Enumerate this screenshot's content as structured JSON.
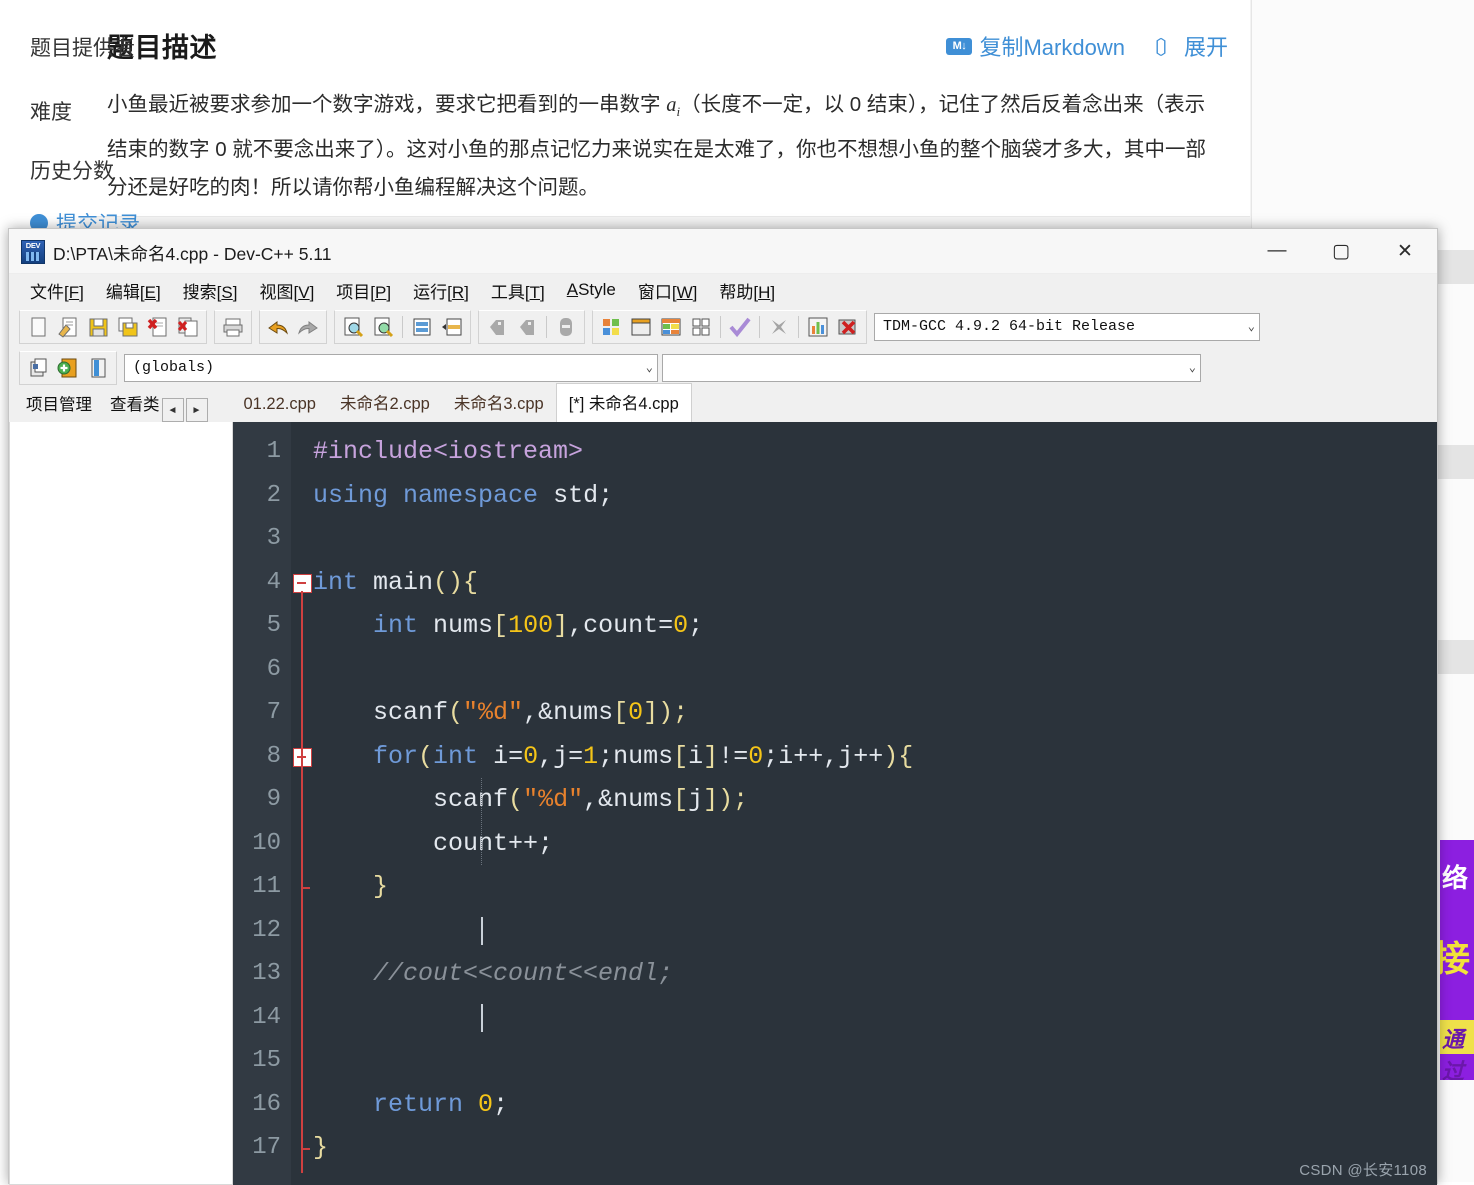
{
  "webpage": {
    "card_title": "题目描述",
    "actions": {
      "copy_markdown": "复制Markdown",
      "copy_markdown_icon": "markdown-badge-icon",
      "expand": "展开",
      "expand_icon": "expand-brackets-icon"
    },
    "description_lines": [
      "小鱼最近被要求参加一个数字游戏，要求它把看到的一串数字 a_i（长度不一定，以 0 结束），记住了然后",
      "反着念出来（表示结束的数字 0 就不要念出来了）。这对小鱼的那点记忆力来说实在是太难了，你也不想",
      "想小鱼的整个脑袋才多大，其中一部分还是好吃的肉！所以请你帮小鱼编程解决这个问题。"
    ],
    "description_part1": "小鱼最近被要求参加一个数字游戏，要求它把看到的一串数字 ",
    "description_var": "a",
    "description_sub": "i",
    "description_part2": "（长度不一定，以 0 结束），记住了然后反着念出来（表示结束的数字 0 就不要念出来了）。这对小鱼的那点记忆力来说实在是太难了，你也不想想小鱼的整个脑袋才多大，其中一部分还是好吃的肉！所以请你帮小鱼编程解决这个问题。",
    "sidebar_items": [
      {
        "label": "题目提供者",
        "type": "text"
      },
      {
        "label": "难度",
        "type": "text"
      },
      {
        "label": "历史分数",
        "type": "text"
      },
      {
        "label": "提交记录",
        "type": "link"
      }
    ],
    "ad": {
      "line1": "络",
      "line2": "接",
      "line3": "通过"
    },
    "accent_blue": "#3f8fd6"
  },
  "devcpp": {
    "title": "D:\\PTA\\未命名4.cpp - Dev-C++ 5.11",
    "app_icon": "devcpp-icon",
    "window_controls": {
      "minimize": "—",
      "maximize": "▢",
      "close": "✕"
    },
    "menus": [
      {
        "label": "文件[",
        "hot": "F",
        "tail": "]"
      },
      {
        "label": "编辑[",
        "hot": "E",
        "tail": "]"
      },
      {
        "label": "搜索[",
        "hot": "S",
        "tail": "]"
      },
      {
        "label": "视图[",
        "hot": "V",
        "tail": "]"
      },
      {
        "label": "项目[",
        "hot": "P",
        "tail": "]"
      },
      {
        "label": "运行[",
        "hot": "R",
        "tail": "]"
      },
      {
        "label": "工具[",
        "hot": "T",
        "tail": "]"
      },
      {
        "label": "AStyle",
        "hot": "",
        "tail": ""
      },
      {
        "label": "窗口[",
        "hot": "W",
        "tail": "]"
      },
      {
        "label": "帮助[",
        "hot": "H",
        "tail": "]"
      }
    ],
    "toolbar_icons_group1": [
      "new-file-icon",
      "open-file-icon",
      "save-icon",
      "save-all-icon",
      "close-file-icon",
      "close-all-icon"
    ],
    "toolbar_icons_group2": [
      "print-icon"
    ],
    "toolbar_icons_group3": [
      "undo-icon",
      "redo-icon"
    ],
    "toolbar_icons_group4": [
      "find-icon",
      "replace-icon",
      "goto-line-icon",
      "goto-function-icon"
    ],
    "toolbar_icons_group5": [
      "back-icon",
      "forward-icon",
      "toggle-icon"
    ],
    "toolbar_icons_group6": [
      "compile-icon",
      "run-icon",
      "compile-run-icon",
      "rebuild-icon",
      "syntax-check-icon",
      "stop-icon",
      "profile-icon",
      "debug-stop-icon"
    ],
    "compiler_combo": {
      "value": "TDM-GCC 4.9.2 64-bit Release",
      "arrow": "⌄"
    },
    "toolbar_icons_group7": [
      "insert-icon",
      "toggle-bookmark-icon",
      "goto-bookmark-icon"
    ],
    "globals_combo": {
      "value": "(globals)",
      "arrow": "⌄"
    },
    "members_combo": {
      "value": "",
      "arrow": "⌄"
    },
    "panel_tabs": [
      {
        "label": "项目管理"
      },
      {
        "label": "查看类"
      }
    ],
    "panel_arrows": {
      "left": "◄",
      "right": "►"
    },
    "file_tabs": [
      {
        "label": "01.22.cpp",
        "active": false
      },
      {
        "label": "未命名2.cpp",
        "active": false
      },
      {
        "label": "未命名3.cpp",
        "active": false
      },
      {
        "label": "[*] 未命名4.cpp",
        "active": true
      }
    ],
    "editor": {
      "line_numbers": [
        1,
        2,
        3,
        4,
        5,
        6,
        7,
        8,
        9,
        10,
        11,
        12,
        13,
        14,
        15,
        16,
        17
      ],
      "fold_markers": [
        4,
        8
      ],
      "lines": [
        {
          "n": 1,
          "tokens": [
            {
              "t": "#include<iostream>",
              "c": "pre"
            }
          ]
        },
        {
          "n": 2,
          "tokens": [
            {
              "t": "using",
              "c": "k"
            },
            {
              "t": " ",
              "c": "pl"
            },
            {
              "t": "namespace",
              "c": "k"
            },
            {
              "t": " std;",
              "c": "idn"
            }
          ]
        },
        {
          "n": 3,
          "tokens": []
        },
        {
          "n": 4,
          "tokens": [
            {
              "t": "int",
              "c": "k"
            },
            {
              "t": " main",
              "c": "idn"
            },
            {
              "t": "(){",
              "c": "br"
            }
          ]
        },
        {
          "n": 5,
          "tokens": [
            {
              "t": "    ",
              "c": "pl"
            },
            {
              "t": "int",
              "c": "k"
            },
            {
              "t": " nums",
              "c": "idn"
            },
            {
              "t": "[",
              "c": "br"
            },
            {
              "t": "100",
              "c": "num"
            },
            {
              "t": "]",
              "c": "br"
            },
            {
              "t": ",count=",
              "c": "idn"
            },
            {
              "t": "0",
              "c": "num"
            },
            {
              "t": ";",
              "c": "idn"
            }
          ]
        },
        {
          "n": 6,
          "tokens": []
        },
        {
          "n": 7,
          "tokens": [
            {
              "t": "    scanf",
              "c": "idn"
            },
            {
              "t": "(",
              "c": "br"
            },
            {
              "t": "\"%d\"",
              "c": "str"
            },
            {
              "t": ",&nums",
              "c": "idn"
            },
            {
              "t": "[",
              "c": "br"
            },
            {
              "t": "0",
              "c": "num"
            },
            {
              "t": "]);",
              "c": "br"
            }
          ]
        },
        {
          "n": 8,
          "tokens": [
            {
              "t": "    ",
              "c": "pl"
            },
            {
              "t": "for",
              "c": "k"
            },
            {
              "t": "(",
              "c": "br"
            },
            {
              "t": "int",
              "c": "k"
            },
            {
              "t": " i=",
              "c": "idn"
            },
            {
              "t": "0",
              "c": "num"
            },
            {
              "t": ",j=",
              "c": "idn"
            },
            {
              "t": "1",
              "c": "num"
            },
            {
              "t": ";nums",
              "c": "idn"
            },
            {
              "t": "[",
              "c": "br"
            },
            {
              "t": "i",
              "c": "idn"
            },
            {
              "t": "]",
              "c": "br"
            },
            {
              "t": "!=",
              "c": "idn"
            },
            {
              "t": "0",
              "c": "num"
            },
            {
              "t": ";i++,j++",
              "c": "idn"
            },
            {
              "t": "){",
              "c": "br"
            }
          ]
        },
        {
          "n": 9,
          "tokens": [
            {
              "t": "        scanf",
              "c": "idn"
            },
            {
              "t": "(",
              "c": "br"
            },
            {
              "t": "\"%d\"",
              "c": "str"
            },
            {
              "t": ",&nums",
              "c": "idn"
            },
            {
              "t": "[",
              "c": "br"
            },
            {
              "t": "j",
              "c": "idn"
            },
            {
              "t": "]);",
              "c": "br"
            }
          ]
        },
        {
          "n": 10,
          "tokens": [
            {
              "t": "        count++;",
              "c": "idn"
            }
          ]
        },
        {
          "n": 11,
          "tokens": [
            {
              "t": "    ",
              "c": "pl"
            },
            {
              "t": "}",
              "c": "br"
            }
          ]
        },
        {
          "n": 12,
          "tokens": []
        },
        {
          "n": 13,
          "tokens": [
            {
              "t": "    //cout<<count<<endl;",
              "c": "cm"
            }
          ]
        },
        {
          "n": 14,
          "tokens": []
        },
        {
          "n": 15,
          "tokens": []
        },
        {
          "n": 16,
          "tokens": [
            {
              "t": "    ",
              "c": "pl"
            },
            {
              "t": "return",
              "c": "k"
            },
            {
              "t": " ",
              "c": "pl"
            },
            {
              "t": "0",
              "c": "num"
            },
            {
              "t": ";",
              "c": "idn"
            }
          ]
        },
        {
          "n": 17,
          "tokens": [
            {
              "t": "}",
              "c": "br"
            }
          ]
        }
      ],
      "colors": {
        "background": "#2b333b",
        "gutter_background": "#323a43",
        "line_number": "#8d9aa3",
        "keyword": "#6f9ad8",
        "preprocessor": "#c7a3dd",
        "number": "#f5c518",
        "string": "#e8822d",
        "bracket": "#e8dca0",
        "comment": "#8a9199",
        "identifier": "#e3e8ee",
        "fold_marker": "#cf4040"
      }
    },
    "watermark": "CSDN @长安1108"
  }
}
